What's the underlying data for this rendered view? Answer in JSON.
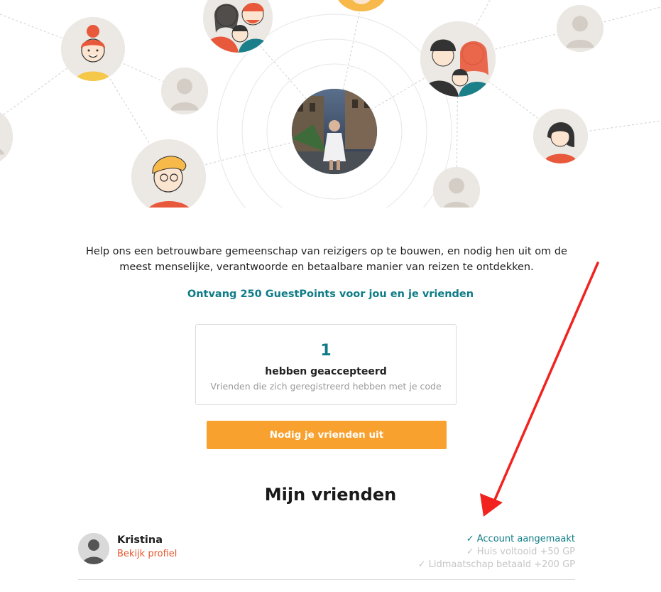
{
  "intro": "Help ons een betrouwbare gemeenschap van reizigers op te bouwen, en nodig hen uit om de meest menselijke, verantwoorde en betaalbare manier van reizen te ontdekken.",
  "reward_text": "Ontvang 250 GuestPoints voor jou en je vrienden",
  "stats": {
    "count": "1",
    "label": "hebben geaccepteerd",
    "sub": "Vrienden die zich geregistreerd hebben met je code"
  },
  "invite_button": "Nodig je vrienden uit",
  "friends_title": "Mijn vrienden",
  "friend": {
    "name": "Kristina",
    "profile_link": "Bekijk profiel",
    "steps": [
      {
        "label": "✓ Account aangemaakt",
        "status": "done"
      },
      {
        "label": "✓ Huis voltooid +50 GP",
        "status": "pending"
      },
      {
        "label": "✓ Lidmaatschap betaald +200 GP",
        "status": "pending"
      }
    ]
  },
  "colors": {
    "accent": "#0e7c86",
    "button": "#f9a12e",
    "link": "#e4572e",
    "annotation_arrow": "#f2231f"
  }
}
